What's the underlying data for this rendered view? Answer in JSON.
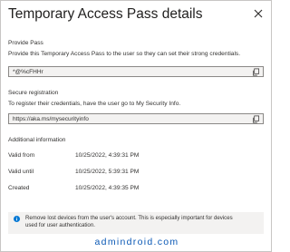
{
  "panel": {
    "title": "Temporary Access Pass details"
  },
  "provide_pass": {
    "label": "Provide Pass",
    "description": "Provide this Temporary Access Pass to the user so they can set their strong credentials.",
    "value": "*@%cFHHr"
  },
  "secure_registration": {
    "label": "Secure registration",
    "description": "To register their credentials, have the user go to My Security Info.",
    "value": "https://aka.ms/mysecurityinfo"
  },
  "additional_information": {
    "label": "Additional information",
    "rows": [
      {
        "name": "Valid from",
        "value": "10/25/2022, 4:39:31 PM"
      },
      {
        "name": "Valid until",
        "value": "10/25/2022, 5:39:31 PM"
      },
      {
        "name": "Created",
        "value": "10/25/2022, 4:39:35 PM"
      }
    ]
  },
  "info_bar": {
    "line1": "Remove lost devices from the user's account. This is especially important for devices",
    "line2": "used for user authentication."
  },
  "watermark": "admindroid.com",
  "colors": {
    "accent": "#0078d4",
    "watermark": "#0a58b5",
    "field_background": "#f3f2f1",
    "info_background": "#f3f2f1"
  },
  "icons": {
    "close": "close-icon",
    "copy": "copy-icon",
    "info": "info-icon"
  }
}
